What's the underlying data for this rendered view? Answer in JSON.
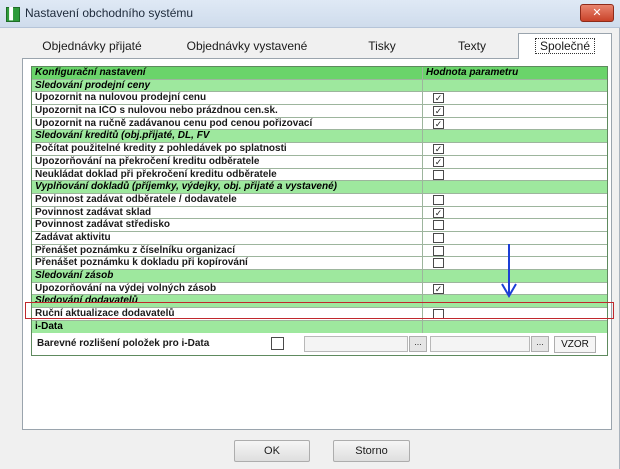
{
  "window": {
    "title": "Nastavení obchodního systému",
    "close_symbol": "✕"
  },
  "tabs": [
    {
      "label": "Objednávky přijaté"
    },
    {
      "label": "Objednávky vystavené"
    },
    {
      "label": "Tisky"
    },
    {
      "label": "Texty"
    },
    {
      "label": "Společné",
      "active": true
    }
  ],
  "grid": {
    "header": {
      "label": "Konfigurační nastavení",
      "value": "Hodnota parametru"
    },
    "rows": [
      {
        "kind": "section",
        "label": "Sledování prodejní ceny"
      },
      {
        "kind": "item",
        "label": "Upozornit na nulovou prodejní cenu",
        "checked": true
      },
      {
        "kind": "item",
        "label": "Upozornit na IČO s nulovou nebo prázdnou cen.sk.",
        "checked": true
      },
      {
        "kind": "item",
        "label": "Upozornit na ručně zadávanou cenu pod cenou pořizovací",
        "checked": true
      },
      {
        "kind": "section",
        "label": "Sledování kreditů (obj.přijaté, DL, FV"
      },
      {
        "kind": "item",
        "label": "Počítat použitelné kredity z pohledávek po splatnosti",
        "checked": true
      },
      {
        "kind": "item",
        "label": "Upozorňování na překročení kreditu odběratele",
        "checked": true
      },
      {
        "kind": "item",
        "label": "Neukládat doklad při překročení kreditu odběratele",
        "checked": false
      },
      {
        "kind": "section",
        "label": "Vyplňování dokladů (příjemky, výdejky, obj. přijaté a vystavené)"
      },
      {
        "kind": "item",
        "label": "Povinnost zadávat odběratele / dodavatele",
        "checked": false
      },
      {
        "kind": "item",
        "label": "Povinnost zadávat sklad",
        "checked": true
      },
      {
        "kind": "item",
        "label": "Povinnost zadávat středisko",
        "checked": false
      },
      {
        "kind": "item",
        "label": "Zadávat aktivitu",
        "checked": false
      },
      {
        "kind": "item",
        "label": "Přenášet poznámku z číselníku organizací",
        "checked": false
      },
      {
        "kind": "item",
        "label": "Přenášet poznámku k dokladu při kopírování",
        "checked": false
      },
      {
        "kind": "section",
        "label": "Sledování zásob"
      },
      {
        "kind": "item",
        "label": "Upozorňování na výdej volných zásob",
        "checked": true
      },
      {
        "kind": "section",
        "label": "Sledování dodavatelů"
      },
      {
        "kind": "item",
        "label": "Ruční aktualizace dodavatelů",
        "checked": false
      },
      {
        "kind": "section_plain",
        "label": "i-Data"
      }
    ],
    "idata_row": {
      "label": "Barevné rozlišení položek pro i-Data",
      "dots1": "...",
      "dots2": "...",
      "vzor": "VZOR"
    },
    "check_glyph": "✓"
  },
  "footer": {
    "ok_label": "OK",
    "cancel_label": "Storno"
  },
  "colors": {
    "header_green": "#6ad46a",
    "section_green": "#9ee89e",
    "highlight_red": "#c0282d",
    "arrow_blue": "#1c3fd6"
  }
}
